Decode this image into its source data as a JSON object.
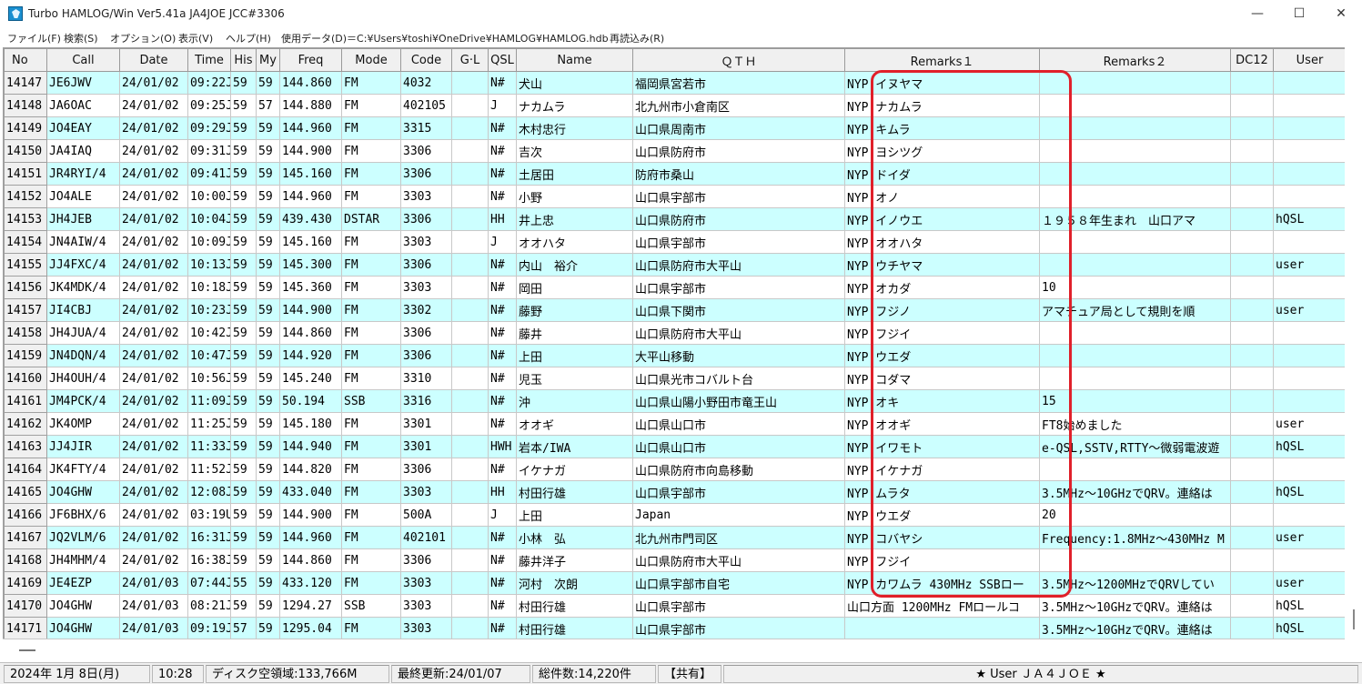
{
  "window": {
    "title": "Turbo HAMLOG/Win Ver5.41a JA4JOE JCC#3306",
    "minimize_glyph": "—",
    "maximize_glyph": "☐",
    "close_glyph": "✕"
  },
  "menu": [
    "ファイル(F)",
    "検索(S)",
    "オプション(O)",
    "表示(V)",
    "ヘルプ(H)",
    "使用データ(D)＝C:¥Users¥toshi¥OneDrive¥HAMLOG¥HAMLOG.hdb",
    "再読込み(R)"
  ],
  "columns": [
    "No",
    "Call",
    "Date",
    "Time",
    "His",
    "My",
    "Freq",
    "Mode",
    "Code",
    "G·L",
    "QSL",
    "Name",
    "ＱＴＨ",
    "Remarks１",
    "Remarks２",
    "DC12",
    "User"
  ],
  "rows": [
    [
      "14147",
      "JE6JWV",
      "24/01/02",
      "09:22J",
      "59",
      "59",
      "144.860",
      "FM",
      "4032",
      "",
      "N#",
      "犬山",
      "福岡県宮若市",
      "NYP イヌヤマ",
      "",
      "",
      ""
    ],
    [
      "14148",
      "JA6OAC",
      "24/01/02",
      "09:25J",
      "59",
      "57",
      "144.880",
      "FM",
      "402105",
      "",
      "J",
      "ナカムラ",
      "北九州市小倉南区",
      "NYP ナカムラ",
      "",
      "",
      ""
    ],
    [
      "14149",
      "JO4EAY",
      "24/01/02",
      "09:29J",
      "59",
      "59",
      "144.960",
      "FM",
      "3315",
      "",
      "N#",
      "木村忠行",
      "山口県周南市",
      "NYP キムラ",
      "",
      "",
      ""
    ],
    [
      "14150",
      "JA4IAQ",
      "24/01/02",
      "09:31J",
      "59",
      "59",
      "144.900",
      "FM",
      "3306",
      "",
      "N#",
      "吉次",
      "山口県防府市",
      "NYP ヨシツグ",
      "",
      "",
      ""
    ],
    [
      "14151",
      "JR4RYI/4",
      "24/01/02",
      "09:41J",
      "59",
      "59",
      "145.160",
      "FM",
      "3306",
      "",
      "N#",
      "土居田",
      "防府市桑山",
      "NYP ドイダ",
      "",
      "",
      ""
    ],
    [
      "14152",
      "JO4ALE",
      "24/01/02",
      "10:00J",
      "59",
      "59",
      "144.960",
      "FM",
      "3303",
      "",
      "N#",
      "小野",
      "山口県宇部市",
      "NYP オノ",
      "",
      "",
      ""
    ],
    [
      "14153",
      "JH4JEB",
      "24/01/02",
      "10:04J",
      "59",
      "59",
      "439.430",
      "DSTAR",
      "3306",
      "",
      "HH",
      "井上忠",
      "山口県防府市",
      "NYP イノウエ",
      "１９５８年生まれ　山口アマ",
      "",
      "hQSL"
    ],
    [
      "14154",
      "JN4AIW/4",
      "24/01/02",
      "10:09J",
      "59",
      "59",
      "145.160",
      "FM",
      "3303",
      "",
      "J",
      "オオハタ",
      "山口県宇部市",
      "NYP オオハタ",
      "",
      "",
      ""
    ],
    [
      "14155",
      "JJ4FXC/4",
      "24/01/02",
      "10:13J",
      "59",
      "59",
      "145.300",
      "FM",
      "3306",
      "",
      "N#",
      "内山　裕介",
      "山口県防府市大平山",
      "NYP ウチヤマ",
      "",
      "",
      "user"
    ],
    [
      "14156",
      "JK4MDK/4",
      "24/01/02",
      "10:18J",
      "59",
      "59",
      "145.360",
      "FM",
      "3303",
      "",
      "N#",
      "岡田",
      "山口県宇部市",
      "NYP オカダ",
      "10",
      "",
      ""
    ],
    [
      "14157",
      "JI4CBJ",
      "24/01/02",
      "10:23J",
      "59",
      "59",
      "144.900",
      "FM",
      "3302",
      "",
      "N#",
      "藤野",
      "山口県下関市",
      "NYP フジノ",
      "アマチュア局として規則を順",
      "",
      "user"
    ],
    [
      "14158",
      "JH4JUA/4",
      "24/01/02",
      "10:42J",
      "59",
      "59",
      "144.860",
      "FM",
      "3306",
      "",
      "N#",
      "藤井",
      "山口県防府市大平山",
      "NYP フジイ",
      "",
      "",
      ""
    ],
    [
      "14159",
      "JN4DQN/4",
      "24/01/02",
      "10:47J",
      "59",
      "59",
      "144.920",
      "FM",
      "3306",
      "",
      "N#",
      "上田",
      "大平山移動",
      "NYP ウエダ",
      "",
      "",
      ""
    ],
    [
      "14160",
      "JH4OUH/4",
      "24/01/02",
      "10:56J",
      "59",
      "59",
      "145.240",
      "FM",
      "3310",
      "",
      "N#",
      "児玉",
      "山口県光市コバルト台",
      "NYP コダマ",
      "",
      "",
      ""
    ],
    [
      "14161",
      "JM4PCK/4",
      "24/01/02",
      "11:09J",
      "59",
      "59",
      "50.194",
      "SSB",
      "3316",
      "",
      "N#",
      "沖",
      "山口県山陽小野田市竜王山",
      "NYP オキ",
      "15",
      "",
      ""
    ],
    [
      "14162",
      "JK4OMP",
      "24/01/02",
      "11:25J",
      "59",
      "59",
      "145.180",
      "FM",
      "3301",
      "",
      "N#",
      "オオギ",
      "山口県山口市",
      "NYP オオギ",
      "FT8始めました",
      "",
      "user"
    ],
    [
      "14163",
      "JJ4JIR",
      "24/01/02",
      "11:33J",
      "59",
      "59",
      "144.940",
      "FM",
      "3301",
      "",
      "HWH",
      "岩本/IWA",
      "山口県山口市",
      "NYP イワモト",
      "e-QSL,SSTV,RTTY～微弱電波遊",
      "",
      "hQSL"
    ],
    [
      "14164",
      "JK4FTY/4",
      "24/01/02",
      "11:52J",
      "59",
      "59",
      "144.820",
      "FM",
      "3306",
      "",
      "N#",
      "イケナガ",
      "山口県防府市向島移動",
      "NYP イケナガ",
      "",
      "",
      ""
    ],
    [
      "14165",
      "JO4GHW",
      "24/01/02",
      "12:08J",
      "59",
      "59",
      "433.040",
      "FM",
      "3303",
      "",
      "HH",
      "村田行雄",
      "山口県宇部市",
      "NYP ムラタ",
      "3.5MHz～10GHzでQRV。連絡は",
      "",
      "hQSL"
    ],
    [
      "14166",
      "JF6BHX/6",
      "24/01/02",
      "03:19U",
      "59",
      "59",
      "144.900",
      "FM",
      "500A",
      "",
      "J",
      "上田",
      "Japan",
      "NYP ウエダ",
      "20",
      "",
      ""
    ],
    [
      "14167",
      "JQ2VLM/6",
      "24/01/02",
      "16:31J",
      "59",
      "59",
      "144.960",
      "FM",
      "402101",
      "",
      "N#",
      "小林　弘",
      "北九州市門司区",
      "NYP コバヤシ",
      "Frequency:1.8MHz～430MHz M",
      "",
      "user"
    ],
    [
      "14168",
      "JH4MHM/4",
      "24/01/02",
      "16:38J",
      "59",
      "59",
      "144.860",
      "FM",
      "3306",
      "",
      "N#",
      "藤井洋子",
      "山口県防府市大平山",
      "NYP フジイ",
      "",
      "",
      ""
    ],
    [
      "14169",
      "JE4EZP",
      "24/01/03",
      "07:44J",
      "55",
      "59",
      "433.120",
      "FM",
      "3303",
      "",
      "N#",
      "河村　次朗",
      "山口県宇部市自宅",
      "NYP カワムラ 430MHz SSBロー",
      "3.5MHz～1200MHzでQRVしてい",
      "",
      "user"
    ],
    [
      "14170",
      "JO4GHW",
      "24/01/03",
      "08:21J",
      "59",
      "59",
      "1294.27",
      "SSB",
      "3303",
      "",
      "N#",
      "村田行雄",
      "山口県宇部市",
      "山口方面 1200MHz FMロールコ",
      "3.5MHz～10GHzでQRV。連絡は",
      "",
      "hQSL"
    ],
    [
      "14171",
      "JO4GHW",
      "24/01/03",
      "09:19J",
      "57",
      "59",
      "1295.04",
      "FM",
      "3303",
      "",
      "N#",
      "村田行雄",
      "山口県宇部市",
      "",
      "3.5MHz～10GHzでQRV。連絡は",
      "",
      "hQSL"
    ]
  ],
  "status": {
    "date": "2024年 1月 8日(月)",
    "time": "10:28",
    "disk_free": "ディスク空領域:133,766M",
    "last_update": "最終更新:24/01/07",
    "total": "総件数:14,220件",
    "shared": "【共有】",
    "user": "★ User ＪＡ４ＪＯＥ ★"
  },
  "colors": {
    "odd_row": "#ccffff",
    "even_row": "#ffffff",
    "highlight_border": "#e0202a"
  }
}
